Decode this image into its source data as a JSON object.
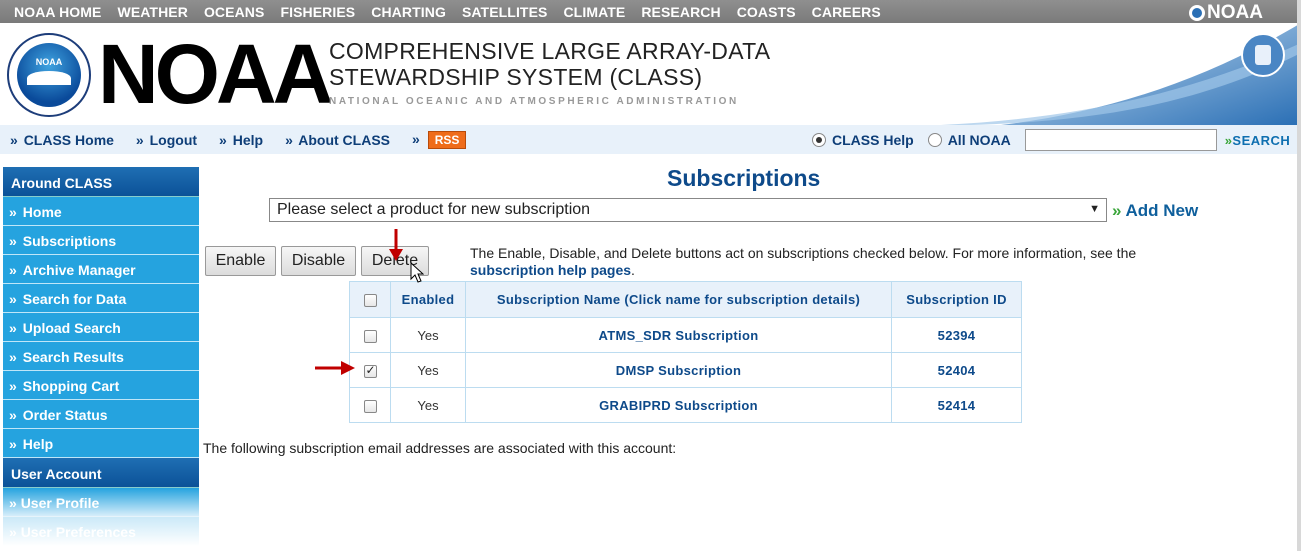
{
  "topnav": {
    "links": [
      "NOAA HOME",
      "WEATHER",
      "OCEANS",
      "FISHERIES",
      "CHARTING",
      "SATELLITES",
      "CLIMATE",
      "RESEARCH",
      "COASTS",
      "CAREERS"
    ],
    "brand": "NOAA"
  },
  "header": {
    "big_logo": "NOAA",
    "title_line1": "COMPREHENSIVE LARGE ARRAY-DATA",
    "title_line2": "STEWARDSHIP SYSTEM (CLASS)",
    "subtitle": "NATIONAL OCEANIC AND ATMOSPHERIC ADMINISTRATION"
  },
  "subnav": {
    "class_home": "CLASS Home",
    "logout": "Logout",
    "help": "Help",
    "about": "About CLASS",
    "rss": "RSS",
    "chevron": "»",
    "search_opt_class": "CLASS Help",
    "search_opt_all": "All NOAA",
    "search_value": "",
    "search_button": "SEARCH",
    "search_selected": "CLASS Help"
  },
  "sidebar": {
    "section1": "Around CLASS",
    "items": [
      "Home",
      "Subscriptions",
      "Archive Manager",
      "Search for Data",
      "Upload Search",
      "Search Results",
      "Shopping Cart",
      "Order Status",
      "Help"
    ],
    "section2": "User Account",
    "items2": [
      "User Profile",
      "User Preferences"
    ]
  },
  "main": {
    "title": "Subscriptions",
    "product_select": "Please select a product for new subscription",
    "add_new": "Add New",
    "add_new_chevron": "»",
    "buttons": {
      "enable": "Enable",
      "disable": "Disable",
      "delete": "Delete"
    },
    "info_text": "The Enable, Disable, and Delete buttons act on subscriptions checked below. For more information, see the",
    "info_link": "subscription help pages",
    "info_end": ".",
    "table": {
      "headers": [
        "Enabled",
        "Subscription Name (Click name for subscription details)",
        "Subscription ID"
      ],
      "rows": [
        {
          "checked": false,
          "enabled": "Yes",
          "name": "ATMS_SDR Subscription",
          "id": "52394"
        },
        {
          "checked": true,
          "enabled": "Yes",
          "name": "DMSP Subscription",
          "id": "52404"
        },
        {
          "checked": false,
          "enabled": "Yes",
          "name": "GRABIPRD Subscription",
          "id": "52414"
        }
      ]
    },
    "email_note": "The following subscription email addresses are associated with this account:"
  },
  "colors": {
    "topnav_bg": "#858585",
    "sidebar_item": "#25a3df",
    "sidebar_head": "#0b5298",
    "link_blue": "#0e4a8a",
    "annotation_red": "#c00000"
  }
}
